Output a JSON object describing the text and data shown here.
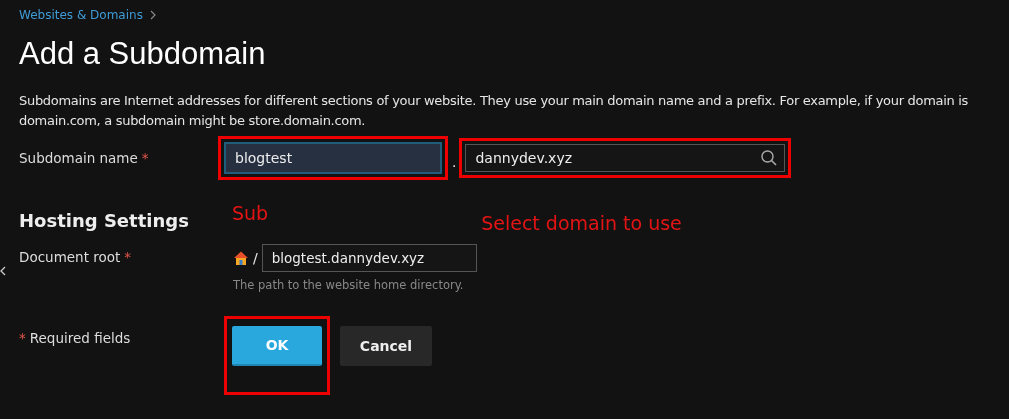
{
  "breadcrumb": [
    {
      "label": "Websites & Domains"
    }
  ],
  "title": "Add a Subdomain",
  "description": "Subdomains are Internet addresses for different sections of your website. They use your main domain name and a prefix. For example, if your domain is domain.com, a subdomain might be store.domain.com.",
  "subdomain_row": {
    "label": "Subdomain name",
    "required_mark": "*",
    "value": "blogtest",
    "focused": true,
    "separator": ".",
    "domain": "dannydev.xyz"
  },
  "section_title": "Hosting Settings",
  "document_root": {
    "label": "Document root",
    "required_mark": "*",
    "separator": "/",
    "value": "blogtest.dannydev.xyz",
    "hint": "The path to the website home directory."
  },
  "required_note": {
    "mark": "*",
    "text": "Required fields"
  },
  "buttons": [
    {
      "kind": "primary",
      "label": "OK"
    },
    {
      "kind": "secondary",
      "label": "Cancel"
    }
  ],
  "annotations": [
    {
      "text": "Sub"
    },
    {
      "text": "Select domain to use"
    }
  ]
}
